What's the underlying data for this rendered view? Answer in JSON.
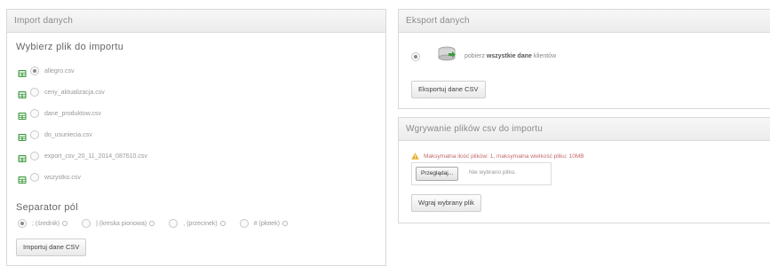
{
  "import_panel": {
    "header": "Import danych",
    "choose_file_title": "Wybierz plik do importu",
    "files": [
      {
        "name": "allegro.csv",
        "selected": true
      },
      {
        "name": "ceny_aktualizacja.csv",
        "selected": false
      },
      {
        "name": "dane_produktow.csv",
        "selected": false
      },
      {
        "name": "do_usuniecia.csv",
        "selected": false
      },
      {
        "name": "export_csv_20_11_2014_087610.csv",
        "selected": false
      },
      {
        "name": "wszystko.csv",
        "selected": false
      }
    ],
    "separator_title": "Separator pól",
    "separators": [
      {
        "label": "; (średnik)",
        "selected": true
      },
      {
        "label": "| (kreska pionowa)",
        "selected": false
      },
      {
        "label": ", (przecinek)",
        "selected": false
      },
      {
        "label": "# (płotek)",
        "selected": false
      }
    ],
    "import_button": "Importuj dane CSV"
  },
  "export_panel": {
    "header": "Eksport danych",
    "option_prefix": "pobierz",
    "option_bold": "wszystkie dane",
    "option_suffix": "klientów",
    "export_button": "Eksportuj dane CSV"
  },
  "upload_panel": {
    "header": "Wgrywanie plików csv do importu",
    "warning": "Maksymalna ilość plików: 1, maksymalna wielkość pliku: 10MB",
    "browse_button": "Przeglądaj...",
    "no_file_text": "Nie wybrano pliku.",
    "upload_button": "Wgraj wybrany plik"
  },
  "colors": {
    "csv_icon": "#3f9a3f",
    "warning": "#e8b12a",
    "warning_text": "#c46a6a"
  }
}
